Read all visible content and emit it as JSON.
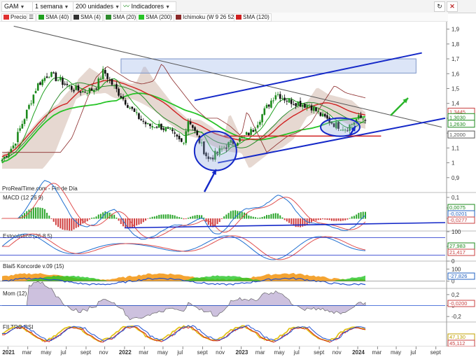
{
  "toolbar": {
    "symbol": "GAM",
    "period": "1 semana",
    "units": "200 unidades",
    "indicators": "Indicadores",
    "refresh_icon": "refresh-icon",
    "close_icon": "close-icon"
  },
  "legend": [
    {
      "label": "Precio",
      "color": "#e03030"
    },
    {
      "label": "SMA (40)",
      "color": "#1fa01f"
    },
    {
      "label": "SMA (4)",
      "color": "#333333"
    },
    {
      "label": "SMA (20)",
      "color": "#2e8b2e"
    },
    {
      "label": "SMA (200)",
      "color": "#27c427"
    },
    {
      "label": "Ichimoku (W 9 26 52)",
      "color": "#8b2a2a"
    },
    {
      "label": "SMA (120)",
      "color": "#d02020"
    }
  ],
  "watermark": "ProRealTime.com - Fin de Día",
  "colors": {
    "up": "#1c8a1c",
    "down": "#111111",
    "trend": "#1428c8",
    "macd": "#1f6fd0",
    "signal": "#e05050"
  },
  "chart_data": [
    {
      "type": "candlestick",
      "title": "Precio",
      "ylim": [
        0.8,
        1.95
      ],
      "y_ticks": [
        "1,9",
        "1,8",
        "1,7",
        "1,6",
        "1,5",
        "1,4",
        "1,3",
        "1,2",
        "1,1",
        "1",
        "0,9"
      ],
      "y_tick_values": [
        1.9,
        1.8,
        1.7,
        1.6,
        1.5,
        1.4,
        1.3,
        1.2,
        1.1,
        1.0,
        0.9
      ],
      "x_labels": [
        "2021",
        "mar",
        "may",
        "jul",
        "sept",
        "nov",
        "2022",
        "mar",
        "may",
        "jul",
        "sept",
        "nov",
        "2023",
        "mar",
        "may",
        "jul",
        "sept",
        "nov",
        "2024",
        "mar",
        "may",
        "jul",
        "sept"
      ],
      "x_years": [
        2021,
        2021.17,
        2021.33,
        2021.5,
        2021.67,
        2021.83,
        2022,
        2022.17,
        2022.33,
        2022.5,
        2022.67,
        2022.83,
        2023,
        2023.17,
        2023.33,
        2023.5,
        2023.67,
        2023.83,
        2024,
        2024.17,
        2024.33,
        2024.5,
        2024.67
      ],
      "key_points": [
        {
          "x": 2020.95,
          "y": 1.02
        },
        {
          "x": 2021.05,
          "y": 1.12
        },
        {
          "x": 2021.15,
          "y": 1.32
        },
        {
          "x": 2021.25,
          "y": 1.52
        },
        {
          "x": 2021.35,
          "y": 1.6
        },
        {
          "x": 2021.45,
          "y": 1.55
        },
        {
          "x": 2021.55,
          "y": 1.5
        },
        {
          "x": 2021.65,
          "y": 1.48
        },
        {
          "x": 2021.75,
          "y": 1.5
        },
        {
          "x": 2021.82,
          "y": 1.62
        },
        {
          "x": 2021.9,
          "y": 1.52
        },
        {
          "x": 2022.0,
          "y": 1.42
        },
        {
          "x": 2022.1,
          "y": 1.32
        },
        {
          "x": 2022.2,
          "y": 1.25
        },
        {
          "x": 2022.3,
          "y": 1.25
        },
        {
          "x": 2022.4,
          "y": 1.2
        },
        {
          "x": 2022.5,
          "y": 1.13
        },
        {
          "x": 2022.55,
          "y": 1.3
        },
        {
          "x": 2022.62,
          "y": 1.18
        },
        {
          "x": 2022.72,
          "y": 1.02
        },
        {
          "x": 2022.8,
          "y": 1.07
        },
        {
          "x": 2022.9,
          "y": 1.13
        },
        {
          "x": 2023.0,
          "y": 1.16
        },
        {
          "x": 2023.1,
          "y": 1.22
        },
        {
          "x": 2023.2,
          "y": 1.35
        },
        {
          "x": 2023.3,
          "y": 1.47
        },
        {
          "x": 2023.4,
          "y": 1.42
        },
        {
          "x": 2023.5,
          "y": 1.4
        },
        {
          "x": 2023.6,
          "y": 1.38
        },
        {
          "x": 2023.7,
          "y": 1.31
        },
        {
          "x": 2023.8,
          "y": 1.26
        },
        {
          "x": 2023.9,
          "y": 1.23
        },
        {
          "x": 2024.0,
          "y": 1.3
        },
        {
          "x": 2024.08,
          "y": 1.303
        }
      ],
      "price_tags": [
        {
          "text": "1,3445",
          "y": 1.3445,
          "color": "#c84040"
        },
        {
          "text": "1,3030",
          "y": 1.303,
          "color": "#1c8a1c"
        },
        {
          "text": "1,2630",
          "y": 1.263,
          "color": "#1c8a1c"
        },
        {
          "text": "1,2000",
          "y": 1.2,
          "color": "#555555"
        }
      ],
      "sma_200_end": 1.31,
      "sma_120_end": 1.29
    },
    {
      "type": "line",
      "title": "MACD (12 26 9)",
      "y_ticks": [
        "0,1",
        "0,05",
        "0"
      ],
      "y_tick_values": [
        0.1,
        0.05,
        0.0
      ],
      "ylim": [
        -0.06,
        0.12
      ],
      "tags": [
        {
          "text": "0,0075",
          "color": "#1c8a1c"
        },
        {
          "text": "-0,0201",
          "color": "#2060c0"
        },
        {
          "text": "-0,0277",
          "color": "#c84040"
        }
      ]
    },
    {
      "type": "line",
      "title": "Estocástico (26 8 5)",
      "y_ticks": [
        "100",
        "50",
        "0"
      ],
      "y_tick_values": [
        100,
        50,
        0
      ],
      "ylim": [
        0,
        100
      ],
      "tags": [
        {
          "text": "27,983",
          "color": "#1c8a1c"
        },
        {
          "text": "21,417",
          "color": "#c84040"
        }
      ]
    },
    {
      "type": "area",
      "title": "Blai5 Koncorde v.09 (15)",
      "y_ticks": [
        "100",
        "0"
      ],
      "y_tick_values": [
        100,
        0
      ],
      "ylim": [
        -60,
        160
      ],
      "tags": [
        {
          "text": "-27,826",
          "color": "#2060c0"
        }
      ]
    },
    {
      "type": "area",
      "title": "Mom (12)",
      "y_ticks": [
        "0,2",
        "0",
        "-0,2"
      ],
      "y_tick_values": [
        0.2,
        0.0,
        -0.2
      ],
      "ylim": [
        -0.3,
        0.3
      ],
      "tags": [
        {
          "text": "-0,0200",
          "color": "#c84040"
        }
      ]
    },
    {
      "type": "line",
      "title": "FILTRO RSI",
      "y_ticks": [],
      "y_tick_values": [],
      "ylim": [
        20,
        80
      ],
      "tags": [
        {
          "text": "47,130",
          "color": "#c0a000"
        },
        {
          "text": "45,112",
          "color": "#c84040"
        }
      ]
    }
  ]
}
